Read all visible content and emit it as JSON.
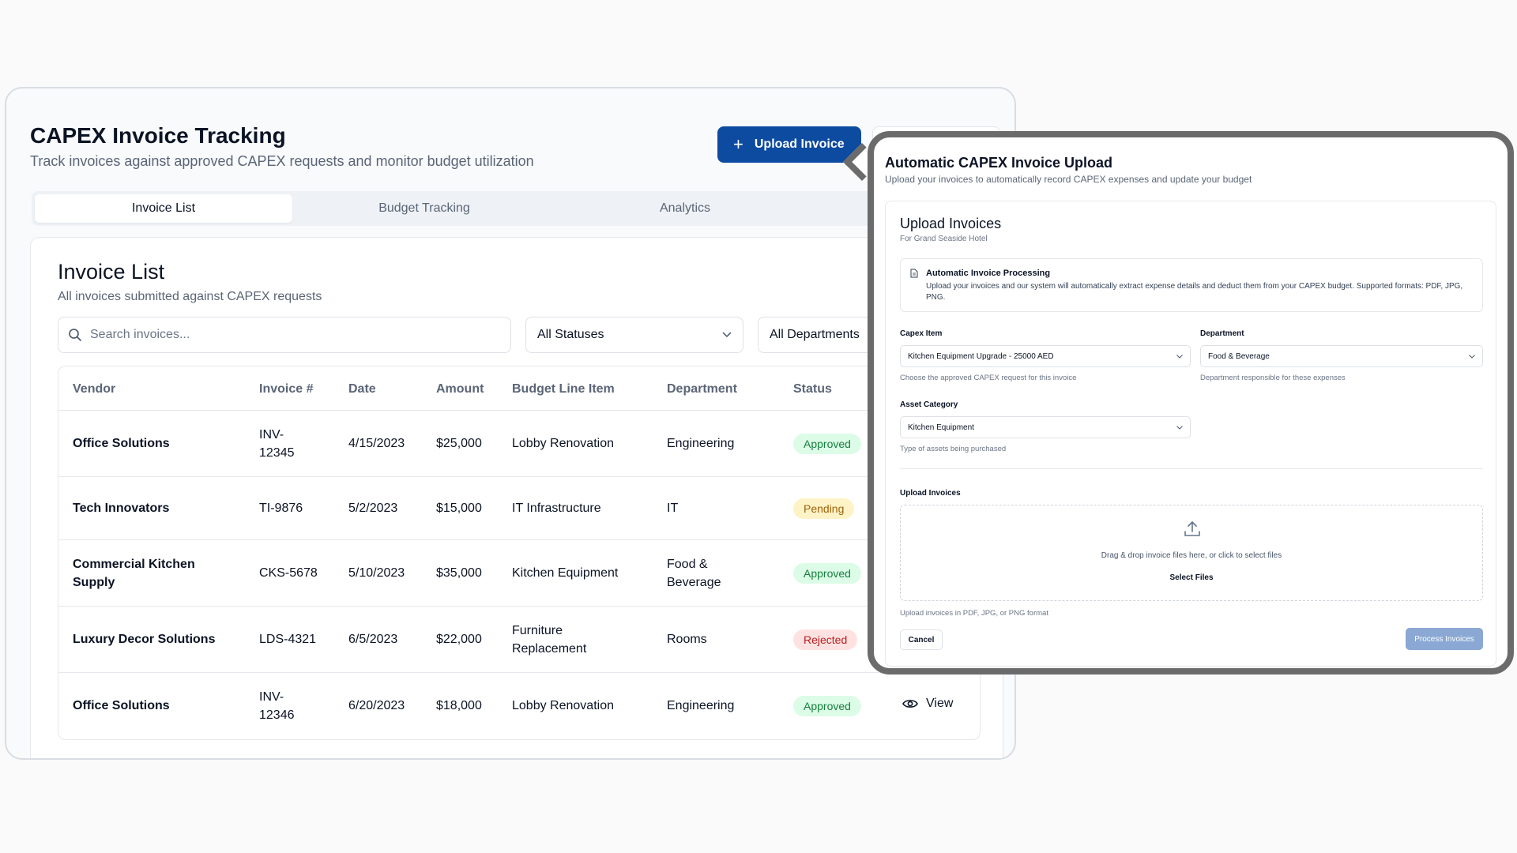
{
  "header": {
    "title": "CAPEX Invoice Tracking",
    "subtitle": "Track invoices against approved CAPEX requests and monitor budget utilization",
    "upload_label": "Upload Invoice"
  },
  "tabs": [
    {
      "label": "Invoice List",
      "active": true
    },
    {
      "label": "Budget Tracking",
      "active": false
    },
    {
      "label": "Analytics",
      "active": false
    }
  ],
  "invoice_list": {
    "title": "Invoice List",
    "subtitle": "All invoices submitted against CAPEX requests",
    "search_placeholder": "Search invoices...",
    "status_filter": "All Statuses",
    "department_filter": "All Departments",
    "columns": [
      "Vendor",
      "Invoice #",
      "Date",
      "Amount",
      "Budget Line Item",
      "Department",
      "Status"
    ],
    "rows": [
      {
        "vendor": "Office Solutions",
        "invoice": "INV-12345",
        "date": "4/15/2023",
        "amount": "$25,000",
        "line_item": "Lobby Renovation",
        "department": "Engineering",
        "status": "Approved"
      },
      {
        "vendor": "Tech Innovators",
        "invoice": "TI-9876",
        "date": "5/2/2023",
        "amount": "$15,000",
        "line_item": "IT Infrastructure",
        "department": "IT",
        "status": "Pending"
      },
      {
        "vendor": "Commercial Kitchen Supply",
        "invoice": "CKS-5678",
        "date": "5/10/2023",
        "amount": "$35,000",
        "line_item": "Kitchen Equipment",
        "department": "Food & Beverage",
        "status": "Approved"
      },
      {
        "vendor": "Luxury Decor Solutions",
        "invoice": "LDS-4321",
        "date": "6/5/2023",
        "amount": "$22,000",
        "line_item": "Furniture Replacement",
        "department": "Rooms",
        "status": "Rejected"
      },
      {
        "vendor": "Office Solutions",
        "invoice": "INV-12346",
        "date": "6/20/2023",
        "amount": "$18,000",
        "line_item": "Lobby Renovation",
        "department": "Engineering",
        "status": "Approved"
      }
    ],
    "view_label": "View"
  },
  "modal": {
    "title": "Automatic CAPEX Invoice Upload",
    "subtitle": "Upload your invoices to automatically record CAPEX expenses and update your budget",
    "card_title": "Upload Invoices",
    "card_subtitle": "For Grand Seaside Hotel",
    "info_title": "Automatic Invoice Processing",
    "info_body": "Upload your invoices and our system will automatically extract expense details and deduct them from your CAPEX budget. Supported formats: PDF, JPG, PNG.",
    "capex_label": "Capex Item",
    "capex_value": "Kitchen Equipment Upgrade - 25000 AED",
    "capex_hint": "Choose the approved CAPEX request for this invoice",
    "dept_label": "Department",
    "dept_value": "Food & Beverage",
    "dept_hint": "Department responsible for these expenses",
    "asset_label": "Asset Category",
    "asset_value": "Kitchen Equipment",
    "asset_hint": "Type of assets being purchased",
    "upload_label": "Upload Invoices",
    "drop_text": "Drag & drop invoice files here, or click to select files",
    "select_files": "Select Files",
    "format_hint": "Upload invoices in PDF, JPG, or PNG format",
    "cancel": "Cancel",
    "process": "Process Invoices"
  },
  "colors": {
    "primary": "#0d4ba0",
    "approved_bg": "#dcfce7",
    "pending_bg": "#fef3c7",
    "rejected_bg": "#fee2e2",
    "process_disabled": "#8aa8d3"
  }
}
